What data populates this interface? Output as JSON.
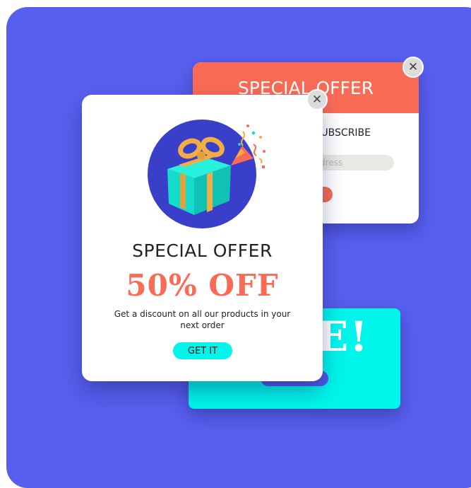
{
  "colors": {
    "background": "#575fef",
    "accent_red": "#fa6b55",
    "accent_cyan": "#00f5eb",
    "dark_blue": "#3a3fc9",
    "gift_box": "#14dccc",
    "gift_ribbon": "#f2ae45"
  },
  "back_popup": {
    "title": "SPECIAL OFFER",
    "subtitle": "ER SUBSCRIBE",
    "email_placeholder": "dress",
    "close_icon": "close-icon"
  },
  "cyan_popup": {
    "headline": "E!"
  },
  "main_popup": {
    "illustration": "gift-box-icon",
    "title": "SPECIAL OFFER",
    "discount": "50% OFF",
    "description": "Get a discount on all our products in your next order",
    "cta_label": "GET IT",
    "close_icon": "close-icon"
  }
}
